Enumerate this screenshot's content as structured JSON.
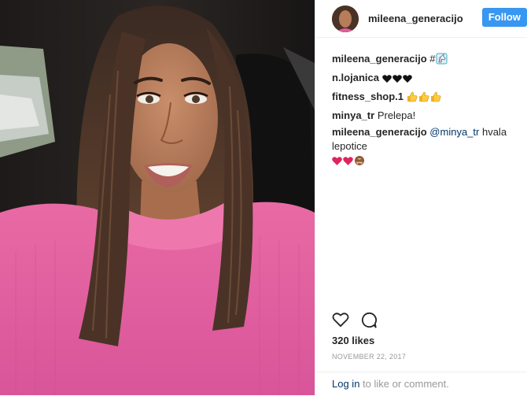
{
  "post": {
    "username": "mileena_generacijo",
    "follow_label": "Follow",
    "caption": {
      "user": "mileena_generacijo",
      "text": "#"
    },
    "comments": [
      {
        "user": "n.lojanica",
        "text": "",
        "emojis": [
          "black-heart",
          "black-heart",
          "black-heart"
        ]
      },
      {
        "user": "fitness_shop.1",
        "text": "",
        "emojis": [
          "thumbs-up",
          "thumbs-up",
          "thumbs-up"
        ]
      },
      {
        "user": "minya_tr",
        "text": "Prelepa!",
        "emojis": []
      },
      {
        "user": "mileena_generacijo",
        "mention": "@minya_tr",
        "text": "hvala lepotice",
        "emojis": [
          "red-heart",
          "red-heart",
          "see-no-evil-monkey"
        ]
      }
    ],
    "likes": "320 likes",
    "date": "NOVEMBER 22, 2017",
    "footer": {
      "login_link": "Log in",
      "rest": "to like or comment."
    }
  },
  "icons": {
    "like": "heart-outline-icon",
    "comment": "comment-bubble-icon",
    "caption_emoji": "unicorn-icon"
  },
  "colors": {
    "follow_bg": "#3897f0",
    "link": "#003569",
    "muted": "#999999",
    "heart_red": "#e0245e"
  }
}
